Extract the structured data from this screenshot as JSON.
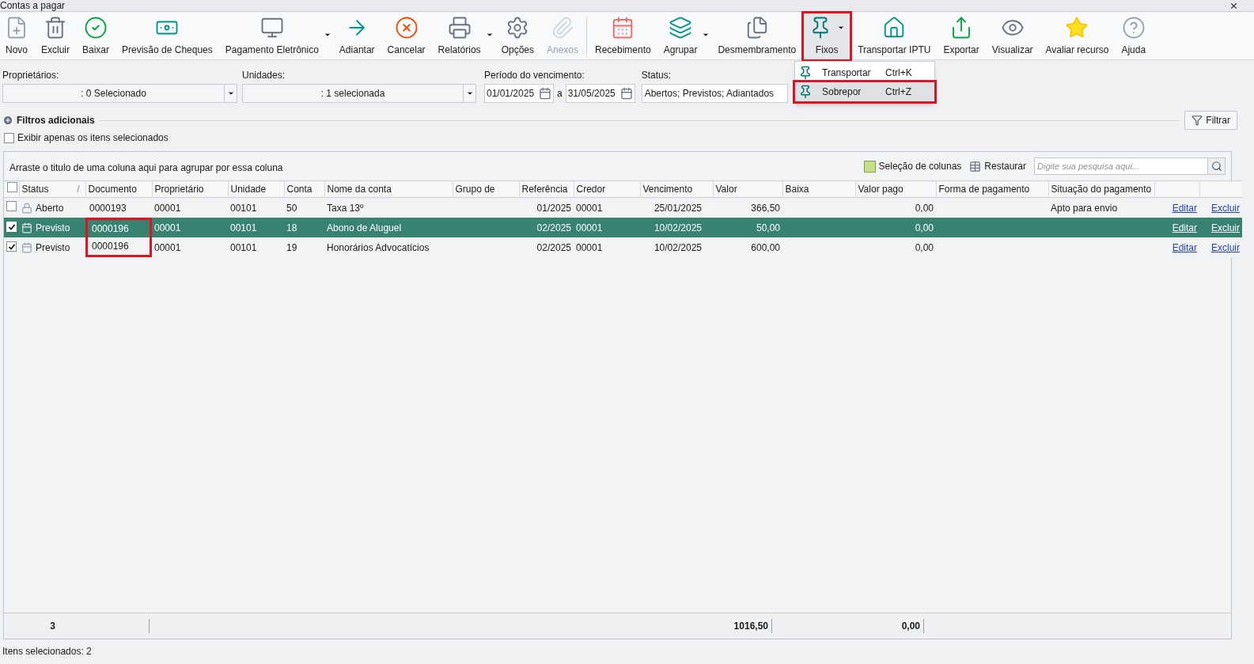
{
  "window": {
    "title": "Contas a pagar",
    "close": "⨯"
  },
  "toolbar": [
    {
      "label": "Novo",
      "dropdown": false,
      "disabled": false,
      "highlighted": false
    },
    {
      "label": "Excluir",
      "dropdown": false,
      "disabled": false,
      "highlighted": false
    },
    {
      "label": "Baixar",
      "dropdown": false,
      "disabled": false,
      "highlighted": false
    },
    {
      "label": "Previsão de Cheques",
      "dropdown": false,
      "disabled": false,
      "highlighted": false
    },
    {
      "label": "Pagamento Eletrônico",
      "dropdown": true,
      "disabled": false,
      "highlighted": false
    },
    {
      "label": "Adiantar",
      "dropdown": false,
      "disabled": false,
      "highlighted": false
    },
    {
      "label": "Cancelar",
      "dropdown": false,
      "disabled": false,
      "highlighted": false
    },
    {
      "label": "Relatórios",
      "dropdown": true,
      "disabled": false,
      "highlighted": false
    },
    {
      "label": "Opções",
      "dropdown": false,
      "disabled": false,
      "highlighted": false
    },
    {
      "label": "Anexos",
      "dropdown": false,
      "disabled": true,
      "highlighted": false
    },
    {
      "label": "Recebimento",
      "dropdown": false,
      "disabled": false,
      "highlighted": false
    },
    {
      "label": "Agrupar",
      "dropdown": true,
      "disabled": false,
      "highlighted": false
    },
    {
      "label": "Desmembramento",
      "dropdown": false,
      "disabled": false,
      "highlighted": false
    },
    {
      "label": "Fixos",
      "dropdown": true,
      "disabled": false,
      "highlighted": true
    },
    {
      "label": "Transportar IPTU",
      "dropdown": false,
      "disabled": false,
      "highlighted": false
    },
    {
      "label": "Exportar",
      "dropdown": false,
      "disabled": false,
      "highlighted": false
    },
    {
      "label": "Visualizar",
      "dropdown": false,
      "disabled": false,
      "highlighted": false
    },
    {
      "label": "Avaliar recurso",
      "dropdown": false,
      "disabled": false,
      "highlighted": false
    },
    {
      "label": "Ajuda",
      "dropdown": false,
      "disabled": false,
      "highlighted": false
    }
  ],
  "menu": [
    {
      "label": "Transportar",
      "shortcut": "Ctrl+K",
      "selected": false
    },
    {
      "label": "Sobrepor",
      "shortcut": "Ctrl+Z",
      "selected": true
    }
  ],
  "filters": {
    "proprietarios": {
      "label": "Proprietários:",
      "value": ": 0 Selecionado"
    },
    "unidades": {
      "label": "Unidades:",
      "value": ": 1 selecionada"
    },
    "periodo": {
      "label": "Período do vencimento:",
      "from": "01/01/2025",
      "sep": "a",
      "to": "31/05/2025"
    },
    "status": {
      "label": "Status:",
      "value": "Abertos; Previstos; Adiantados"
    }
  },
  "extra_filters": "Filtros adicionais",
  "filter_button": "Filtrar",
  "only_selected": {
    "label": "Exibir apenas os itens selecionados",
    "checked": false
  },
  "grid": {
    "group_hint": "Arraste o titulo de uma coluna aqui para agrupar por essa coluna",
    "column_chooser": "Seleção de colunas",
    "restore": "Restaurar",
    "search": {
      "placeholder": "Digite sua pesquisa aqui..."
    },
    "sort_mark": "/",
    "select_all": {
      "checked": false
    },
    "columns": [
      "Status",
      "Documento",
      "Proprietário",
      "Unidade",
      "Conta",
      "Nome da conta",
      "Grupo de",
      "Referência",
      "Credor",
      "Vencimento",
      "Valor",
      "Baixa",
      "Valor pago",
      "Forma de pagamento",
      "Situação do pagamento"
    ],
    "rows": [
      {
        "checked": false,
        "selected": false,
        "kind": "aberto",
        "status": "Aberto",
        "documento": "0000193",
        "doc_highlighted": false,
        "proprietario": "00001",
        "unidade": "00101",
        "conta": "50",
        "nome": "Taxa 13º",
        "referencia": "01/2025",
        "credor": "00001",
        "vencimento": "25/01/2025",
        "valor": "366,50",
        "valor_pago": "0,00",
        "situacao": "Apto para envio",
        "edit": "Editar",
        "delete": "Excluir"
      },
      {
        "checked": true,
        "selected": true,
        "kind": "previsto",
        "status": "Previsto",
        "documento": "0000196",
        "doc_highlighted": true,
        "proprietario": "00001",
        "unidade": "00101",
        "conta": "18",
        "nome": "Abono de Aluguel",
        "referencia": "02/2025",
        "credor": "00001",
        "vencimento": "10/02/2025",
        "valor": "50,00",
        "valor_pago": "0,00",
        "edit": "Editar",
        "delete": "Excluir"
      },
      {
        "checked": true,
        "selected": false,
        "kind": "previsto",
        "status": "Previsto",
        "documento": "0000196",
        "doc_highlighted": true,
        "proprietario": "00001",
        "unidade": "00101",
        "conta": "19",
        "nome": "Honorários Advocatícios",
        "referencia": "02/2025",
        "credor": "00001",
        "vencimento": "10/02/2025",
        "valor": "600,00",
        "valor_pago": "0,00",
        "edit": "Editar",
        "delete": "Excluir"
      }
    ],
    "footer": {
      "count": "3",
      "valor": "1016,50",
      "valor_pago": "0,00"
    }
  },
  "status_bar": "Itens selecionados: 2"
}
